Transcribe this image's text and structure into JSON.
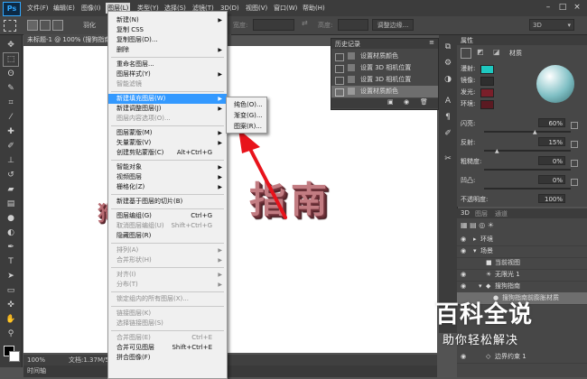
{
  "menubar": {
    "logo": "Ps",
    "items": [
      "文件(F)",
      "编辑(E)",
      "图像(I)",
      "图层(L)",
      "类型(Y)",
      "选择(S)",
      "滤镜(T)",
      "3D(D)",
      "视图(V)",
      "窗口(W)",
      "帮助(H)"
    ],
    "active_index": 3
  },
  "options": {
    "feather_label": "羽化",
    "width_label": "宽度:",
    "height_label": "高度:",
    "refine_edge": "调整边缘...",
    "workspace": "3D"
  },
  "document": {
    "tab_title": "未标题-1 @ 100% (搜狗指南, RGB/8) *",
    "zoom": "100%",
    "doc_info": "文档:1.37M/5.89M",
    "timeline_label": "时间轴"
  },
  "canvas_text": {
    "left_fragment": "狗",
    "main": "指南"
  },
  "history": {
    "title": "历史记录",
    "items": [
      "设置材质颜色",
      "设置 3D 相机位置",
      "设置 3D 相机位置",
      "设置材质颜色"
    ],
    "selected_index": 3
  },
  "properties": {
    "tab": "属性",
    "subtitle": "材质",
    "rows": [
      {
        "label": "漫射:",
        "color": "#1ec8c0"
      },
      {
        "label": "镜像:",
        "color": "#2e2e2e"
      },
      {
        "label": "发光:",
        "color": "#7a1f2a"
      },
      {
        "label": "环境:",
        "color": "#5b1a22"
      }
    ],
    "sliders": [
      {
        "label": "闪亮:",
        "value": "60%",
        "level": 0.6
      },
      {
        "label": "反射:",
        "value": "15%",
        "level": 0.15
      },
      {
        "label": "粗糙度:",
        "value": "0%",
        "level": 0
      },
      {
        "label": "凹凸:",
        "value": "0%",
        "level": 0
      },
      {
        "label": "不透明度:",
        "value": "100%",
        "level": 1
      }
    ]
  },
  "panel3d": {
    "tabs": [
      "3D",
      "图层",
      "通道"
    ],
    "items": [
      "环境",
      "场景",
      "当前视图",
      "无限光 1",
      "搜狗指南",
      "搜狗指南前膨胀材质",
      "边界约束 1"
    ],
    "selected_index": 5
  },
  "layer_menu": {
    "items": [
      {
        "label": "新建(N)",
        "arrow": true
      },
      {
        "label": "复制 CSS"
      },
      {
        "label": "复制图层(D)..."
      },
      {
        "label": "删除",
        "arrow": true
      },
      {
        "sep": true
      },
      {
        "label": "重命名图层..."
      },
      {
        "label": "图层样式(Y)",
        "arrow": true
      },
      {
        "label": "智能滤镜",
        "dis": true
      },
      {
        "sep": true
      },
      {
        "label": "新建填充图层(W)",
        "arrow": true,
        "hl": true
      },
      {
        "label": "新建调整图层(J)",
        "arrow": true
      },
      {
        "label": "图层内容选项(O)...",
        "dis": true
      },
      {
        "sep": true
      },
      {
        "label": "图层蒙版(M)",
        "arrow": true
      },
      {
        "label": "矢量蒙版(V)",
        "arrow": true
      },
      {
        "label": "创建剪贴蒙版(C)",
        "shortcut": "Alt+Ctrl+G"
      },
      {
        "sep": true
      },
      {
        "label": "智能对象",
        "arrow": true
      },
      {
        "label": "视频图层",
        "arrow": true
      },
      {
        "label": "栅格化(Z)",
        "arrow": true
      },
      {
        "sep": true
      },
      {
        "label": "新建基于图层的切片(B)"
      },
      {
        "sep": true
      },
      {
        "label": "图层编组(G)",
        "shortcut": "Ctrl+G"
      },
      {
        "label": "取消图层编组(U)",
        "shortcut": "Shift+Ctrl+G",
        "dis": true
      },
      {
        "label": "隐藏图层(R)"
      },
      {
        "sep": true
      },
      {
        "label": "排列(A)",
        "arrow": true,
        "dis": true
      },
      {
        "label": "合并形状(H)",
        "arrow": true,
        "dis": true
      },
      {
        "sep": true
      },
      {
        "label": "对齐(I)",
        "arrow": true,
        "dis": true
      },
      {
        "label": "分布(T)",
        "arrow": true,
        "dis": true
      },
      {
        "sep": true
      },
      {
        "label": "锁定组内的所有图层(X)...",
        "dis": true
      },
      {
        "sep": true
      },
      {
        "label": "链接图层(K)",
        "dis": true
      },
      {
        "label": "选择链接图层(S)",
        "dis": true
      },
      {
        "sep": true
      },
      {
        "label": "合并图层(E)",
        "shortcut": "Ctrl+E",
        "dis": true
      },
      {
        "label": "合并可见图层",
        "shortcut": "Shift+Ctrl+E"
      },
      {
        "label": "拼合图像(F)"
      }
    ]
  },
  "fill_submenu": {
    "items": [
      "纯色(O)...",
      "渐变(G)...",
      "图案(R)..."
    ]
  },
  "watermark": {
    "title": "百科全说",
    "subtitle": "助你轻松解决"
  }
}
